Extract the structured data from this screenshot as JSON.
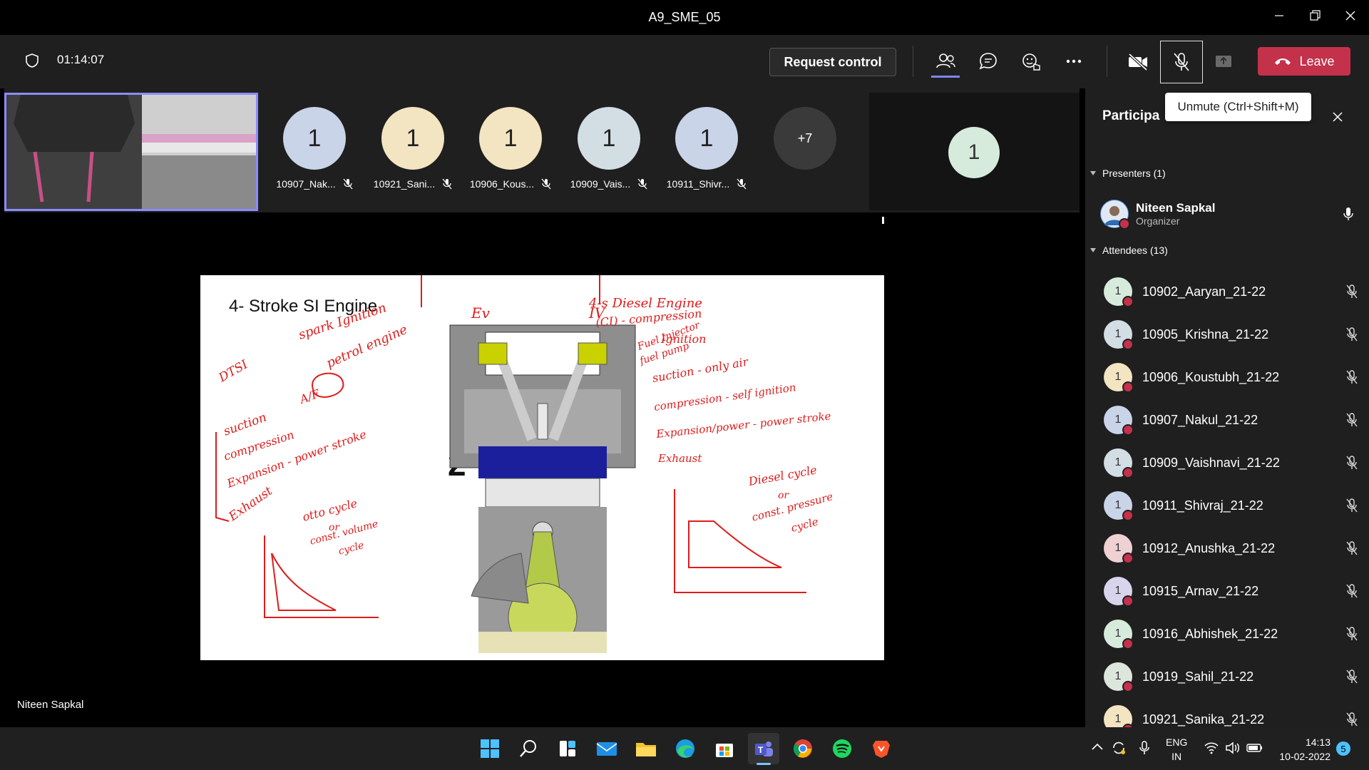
{
  "window": {
    "title": "A9_SME_05",
    "minimize": "—",
    "restore": "❐",
    "close": "✕"
  },
  "toolbar": {
    "timer": "01:14:07",
    "request_control": "Request control",
    "leave": "Leave"
  },
  "tooltip": "Unmute (Ctrl+Shift+M)",
  "gallery": {
    "tiles": [
      {
        "initial": "1",
        "label": "10907_Nak...",
        "color": "#c9d4e8"
      },
      {
        "initial": "1",
        "label": "10921_Sani...",
        "color": "#f3e4c2"
      },
      {
        "initial": "1",
        "label": "10906_Kous...",
        "color": "#f3e4c2"
      },
      {
        "initial": "1",
        "label": "10909_Vais...",
        "color": "#d3dde4"
      },
      {
        "initial": "1",
        "label": "10911_Shivr...",
        "color": "#c9d4e8"
      }
    ],
    "more": "+7",
    "single_tile_initial": "1",
    "single_tile_color": "#d7ebdd"
  },
  "slide": {
    "title": "4- Stroke SI Engine",
    "number": "2",
    "notes_left": [
      "spark Ignition",
      "petrol engine",
      "DTSI",
      "A/F",
      "suction",
      "compression",
      "Expansion - power stroke",
      "Exhaust",
      "otto cycle",
      "or",
      "const. volume",
      "cycle"
    ],
    "notes_right": [
      "4-s Diesel Engine",
      "(CI) - compression",
      "Ignition",
      "Fuel Injector",
      "fuel pump",
      "suction - only air",
      "compression - self ignition",
      "Expansion/power - power stroke",
      "Exhaust",
      "Diesel cycle",
      "or",
      "const. pressure",
      "cycle"
    ],
    "labels": [
      "Ev",
      "IV"
    ]
  },
  "presenter_name": "Niteen Sapkal",
  "panel": {
    "title": "Participa",
    "presenters_header": "Presenters (1)",
    "presenter": {
      "name": "Niteen Sapkal",
      "role": "Organizer"
    },
    "attendees_header": "Attendees (13)",
    "attendees": [
      {
        "name": "10902_Aaryan_21-22",
        "initial": "1",
        "color": "#d7ebdd"
      },
      {
        "name": "10905_Krishna_21-22",
        "initial": "1",
        "color": "#d3dde4"
      },
      {
        "name": "10906_Koustubh_21-22",
        "initial": "1",
        "color": "#f3e4c2"
      },
      {
        "name": "10907_Nakul_21-22",
        "initial": "1",
        "color": "#c9d4e8"
      },
      {
        "name": "10909_Vaishnavi_21-22",
        "initial": "1",
        "color": "#d3dde4"
      },
      {
        "name": "10911_Shivraj_21-22",
        "initial": "1",
        "color": "#c9d4e8"
      },
      {
        "name": "10912_Anushka_21-22",
        "initial": "1",
        "color": "#efd0d3"
      },
      {
        "name": "10915_Arnav_21-22",
        "initial": "1",
        "color": "#d8d4ec"
      },
      {
        "name": "10916_Abhishek_21-22",
        "initial": "1",
        "color": "#d7ebdd"
      },
      {
        "name": "10919_Sahil_21-22",
        "initial": "1",
        "color": "#dde6dd"
      },
      {
        "name": "10921_Sanika_21-22",
        "initial": "1",
        "color": "#f3e4c2"
      }
    ]
  },
  "taskbar": {
    "lang_top": "ENG",
    "lang_bottom": "IN",
    "time": "14:13",
    "date": "10-02-2022",
    "notifications": "5"
  }
}
